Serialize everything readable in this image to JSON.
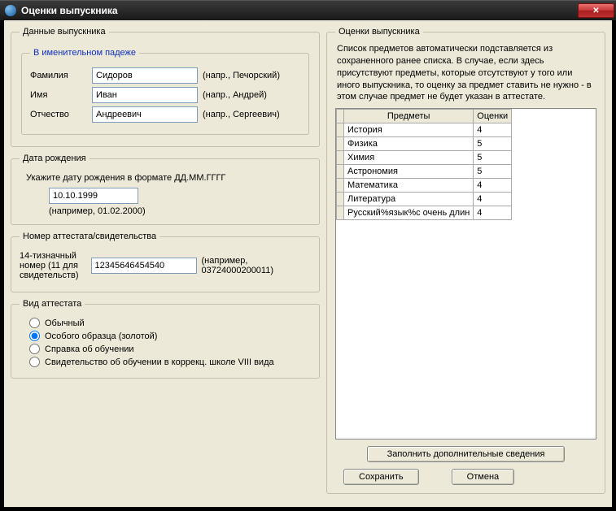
{
  "window": {
    "title": "Оценки выпускника"
  },
  "left": {
    "group_data": "Данные выпускника",
    "group_name": "В именительном падеже",
    "surname_label": "Фамилия",
    "surname_value": "Сидоров",
    "surname_hint": "(напр., Печорский)",
    "name_label": "Имя",
    "name_value": "Иван",
    "name_hint": "(напр., Андрей)",
    "patr_label": "Отчество",
    "patr_value": "Андреевич",
    "patr_hint": "(напр., Сергеевич)",
    "group_dob": "Дата рождения",
    "dob_instr": "Укажите дату рождения в формате ДД.ММ.ГГГГ",
    "dob_value": "10.10.1999",
    "dob_hint": "(например, 01.02.2000)",
    "group_cert": "Номер аттестата/свидетельства",
    "cert_label": "14-тизначный номер (11 для свидетельств)",
    "cert_value": "12345646454540",
    "cert_hint": "(например, 03724000200011)",
    "group_type": "Вид аттестата",
    "type_ordinary": "Обычный",
    "type_gold": "Особого образца (золотой)",
    "type_ref": "Справка об обучении",
    "type_corr": "Свидетельство об обучении в коррекц. школе VIII вида"
  },
  "right": {
    "group": "Оценки выпускника",
    "desc": "Список предметов автоматически подставляется из сохраненного ранее списка. В случае, если здесь присутствуют предметы, которые отсутствуют у того или иного выпускника, то оценку за предмет ставить не нужно - в этом случае предмет не будет указан в аттестате.",
    "col_subject": "Предметы",
    "col_grade": "Оценки",
    "rows": [
      {
        "s": "История",
        "g": "4"
      },
      {
        "s": "Физика",
        "g": "5"
      },
      {
        "s": "Химия",
        "g": "5"
      },
      {
        "s": "Астрономия",
        "g": "5"
      },
      {
        "s": "Математика",
        "g": "4"
      },
      {
        "s": "Литература",
        "g": "4"
      },
      {
        "s": "Русский%язык%с очень длин",
        "g": "4"
      }
    ],
    "btn_extra": "Заполнить дополнительные сведения",
    "btn_save": "Сохранить",
    "btn_cancel": "Отмена"
  }
}
